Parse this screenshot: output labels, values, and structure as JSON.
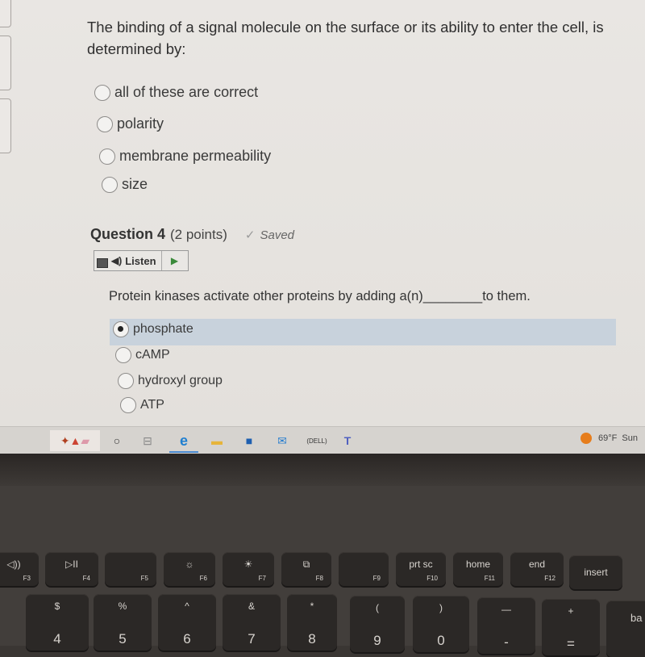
{
  "question3": {
    "text": "The binding of a signal molecule on the surface or its ability to enter the cell, is determined by:",
    "options": [
      {
        "label": "all of these are correct",
        "selected": false
      },
      {
        "label": "polarity",
        "selected": false
      },
      {
        "label": "membrane permeability",
        "selected": false
      },
      {
        "label": "size",
        "selected": false
      }
    ]
  },
  "question4": {
    "title": "Question 4",
    "points": "(2 points)",
    "saved": "Saved",
    "listen": "Listen",
    "text": "Protein kinases activate other proteins by adding a(n)________to them.",
    "options": [
      {
        "label": "phosphate",
        "selected": true
      },
      {
        "label": "cAMP",
        "selected": false
      },
      {
        "label": "hydroxyl group",
        "selected": false
      },
      {
        "label": "ATP",
        "selected": false
      }
    ]
  },
  "taskbar": {
    "weather": "69°F",
    "weather_desc": "Sun"
  },
  "keyboard": {
    "fkeys": [
      {
        "icon": "◁))",
        "fn": "F3"
      },
      {
        "icon": "▷II",
        "fn": "F4"
      },
      {
        "icon": "",
        "fn": "F5"
      },
      {
        "icon": "☼",
        "fn": "F6"
      },
      {
        "icon": "☀",
        "fn": "F7"
      },
      {
        "icon": "⧉",
        "fn": "F8"
      },
      {
        "icon": "",
        "fn": "F9"
      },
      {
        "icon": "prt sc",
        "fn": "F10"
      },
      {
        "icon": "home",
        "fn": "F11"
      },
      {
        "icon": "end",
        "fn": "F12"
      },
      {
        "icon": "insert",
        "fn": ""
      }
    ],
    "numkeys": [
      {
        "top": "$",
        "big": "4"
      },
      {
        "top": "%",
        "big": "5"
      },
      {
        "top": "^",
        "big": "6"
      },
      {
        "top": "&",
        "big": "7"
      },
      {
        "top": "*",
        "big": "8"
      },
      {
        "top": "(",
        "big": "9"
      },
      {
        "top": ")",
        "big": "0"
      },
      {
        "top": "—",
        "big": "-"
      },
      {
        "top": "+",
        "big": "="
      },
      {
        "top": "",
        "big": "ba"
      }
    ]
  }
}
